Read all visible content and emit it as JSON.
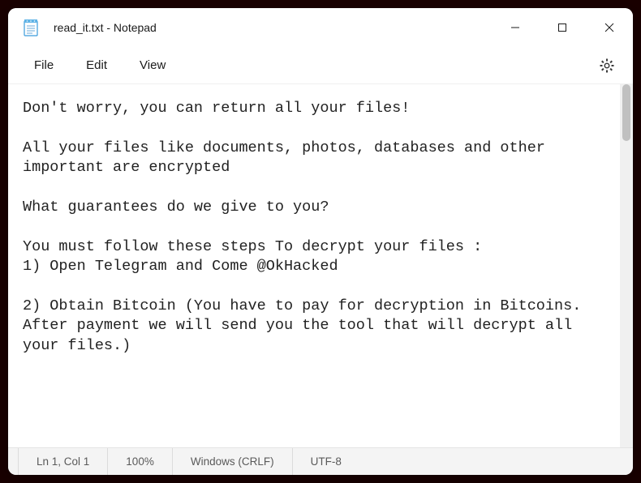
{
  "titlebar": {
    "title": "read_it.txt - Notepad"
  },
  "menu": {
    "file": "File",
    "edit": "Edit",
    "view": "View"
  },
  "content": "Don't worry, you can return all your files!\n\nAll your files like documents, photos, databases and other important are encrypted\n\nWhat guarantees do we give to you?\n\nYou must follow these steps To decrypt your files :\n1) Open Telegram and Come @OkHacked\n\n2) Obtain Bitcoin (You have to pay for decryption in Bitcoins.\nAfter payment we will send you the tool that will decrypt all your files.)",
  "statusbar": {
    "position": "Ln 1, Col 1",
    "zoom": "100%",
    "line_ending": "Windows (CRLF)",
    "encoding": "UTF-8"
  }
}
